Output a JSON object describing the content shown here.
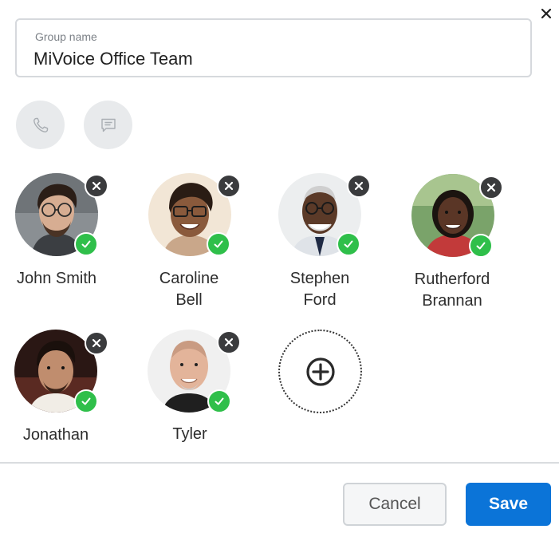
{
  "dialog": {
    "close_icon": "close-icon"
  },
  "group": {
    "label": "Group name",
    "value": "MiVoice Office Team"
  },
  "actions": [
    {
      "icon": "phone-icon"
    },
    {
      "icon": "chat-icon"
    }
  ],
  "members": [
    {
      "line1": "John Smith",
      "line2": ""
    },
    {
      "line1": "Caroline",
      "line2": "Bell"
    },
    {
      "line1": "Stephen",
      "line2": "Ford"
    },
    {
      "line1": "Rutherford",
      "line2": "Brannan"
    },
    {
      "line1": "Jonathan",
      "line2": ""
    },
    {
      "line1": "Tyler",
      "line2": ""
    }
  ],
  "add_member_icon": "plus-circle-icon",
  "footer": {
    "cancel_label": "Cancel",
    "save_label": "Save"
  },
  "colors": {
    "accent": "#0b74d8",
    "check": "#2fbf4a",
    "remove": "#3a3b3d"
  }
}
